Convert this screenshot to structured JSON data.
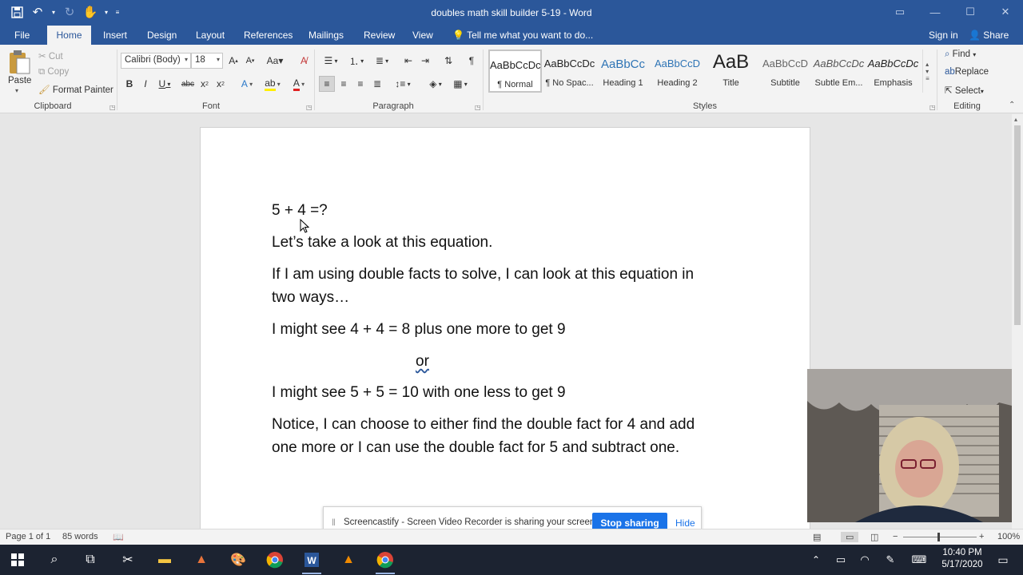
{
  "window": {
    "title": "doubles math skill builder 5-19 - Word"
  },
  "tabs": [
    "File",
    "Home",
    "Insert",
    "Design",
    "Layout",
    "References",
    "Mailings",
    "Review",
    "View"
  ],
  "tell_me": "Tell me what you want to do...",
  "sign_in": "Sign in",
  "share": "Share",
  "clipboard": {
    "paste": "Paste",
    "cut": "Cut",
    "copy": "Copy",
    "format_painter": "Format Painter",
    "label": "Clipboard"
  },
  "font": {
    "name": "Calibri (Body)",
    "size": "18",
    "label": "Font"
  },
  "paragraph": {
    "label": "Paragraph"
  },
  "styles": {
    "label": "Styles",
    "items": [
      {
        "sample": "AaBbCcDc",
        "name": "¶ Normal"
      },
      {
        "sample": "AaBbCcDc",
        "name": "¶ No Spac..."
      },
      {
        "sample": "AaBbCc",
        "name": "Heading 1"
      },
      {
        "sample": "AaBbCcD",
        "name": "Heading 2"
      },
      {
        "sample": "AaB",
        "name": "Title"
      },
      {
        "sample": "AaBbCcD",
        "name": "Subtitle"
      },
      {
        "sample": "AaBbCcDc",
        "name": "Subtle Em..."
      },
      {
        "sample": "AaBbCcDc",
        "name": "Emphasis"
      }
    ]
  },
  "editing": {
    "find": "Find",
    "replace": "Replace",
    "select": "Select",
    "label": "Editing"
  },
  "document": {
    "lines": [
      "5 + 4 =?",
      "Let’s take a look at this equation.",
      "If I am using double facts to solve, I can look at this equation in",
      "two ways…",
      "I might see 4 + 4 = 8 plus one more to get 9",
      "or",
      "I might see 5 + 5 = 10 with one less to get 9",
      "Notice, I can choose to either find the double fact for 4 and add",
      "one more or I can use the double fact for 5 and subtract one."
    ]
  },
  "screencastify": {
    "message": "Screencastify - Screen Video Recorder is sharing your screen.",
    "stop": "Stop sharing",
    "hide": "Hide"
  },
  "status": {
    "page": "Page 1 of 1",
    "words": "85 words",
    "zoom": "100%"
  },
  "clock": {
    "time": "10:40 PM",
    "date": "5/17/2020"
  },
  "colors": {
    "brand": "#2b579a",
    "taskbar": "#1c2331",
    "stop_button": "#1a73e8"
  }
}
